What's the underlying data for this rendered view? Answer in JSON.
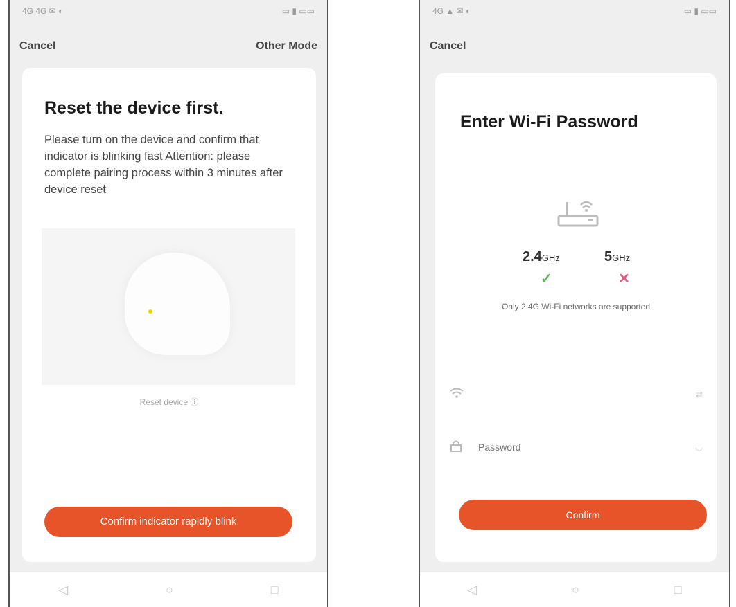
{
  "screen1": {
    "status_left": "4G 4G ✉ ◐",
    "status_right": "▭ ▮ ▭▭",
    "cancel_label": "Cancel",
    "other_mode_label": "Other Mode",
    "title": "Reset the device first.",
    "description": "Please turn on the device and confirm that indicator is blinking fast Attention: please complete pairing process within 3 minutes after device reset",
    "caption": "Reset device ⓘ",
    "confirm_button": "Confirm indicator rapidly blink"
  },
  "screen2": {
    "status_left": "4G ▲ ✉ ◐",
    "status_right": "▭ ▮ ▭▭",
    "cancel_label": "Cancel",
    "title": "Enter Wi-Fi Password",
    "band_24_value": "2.4",
    "band_24_unit": "GHz",
    "band_5_value": "5",
    "band_5_unit": "GHz",
    "check_mark": "✓",
    "cross_mark": "✕",
    "note": "Only 2.4G Wi-Fi networks are supported",
    "wifi_value": "",
    "password_placeholder": "Password",
    "confirm_button": "Confirm"
  },
  "icons": {
    "back": "back-icon",
    "home": "home-icon",
    "recent": "recent-apps-icon",
    "wifi": "wifi-icon",
    "lock": "lock-icon",
    "router": "router-icon"
  },
  "colors": {
    "accent": "#e8542a",
    "check": "#5cb85c",
    "cross": "#e85a7a"
  }
}
